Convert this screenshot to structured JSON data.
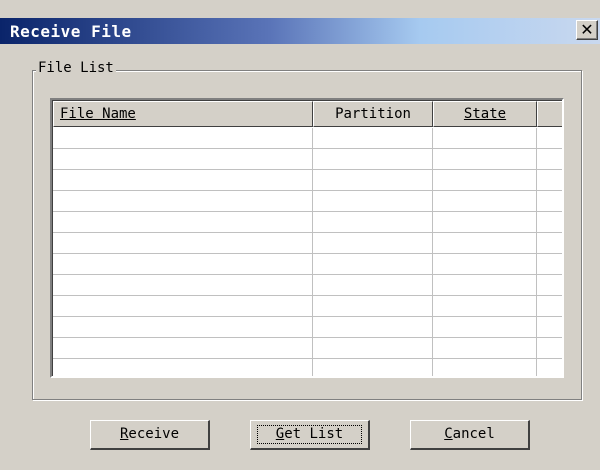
{
  "window": {
    "title": "Receive File",
    "close_glyph": "✕"
  },
  "group": {
    "label": "File List"
  },
  "list": {
    "columns": [
      "File Name",
      "Partition",
      "State",
      ""
    ],
    "rows": [
      [
        "",
        "",
        "",
        ""
      ],
      [
        "",
        "",
        "",
        ""
      ],
      [
        "",
        "",
        "",
        ""
      ],
      [
        "",
        "",
        "",
        ""
      ],
      [
        "",
        "",
        "",
        ""
      ],
      [
        "",
        "",
        "",
        ""
      ],
      [
        "",
        "",
        "",
        ""
      ],
      [
        "",
        "",
        "",
        ""
      ],
      [
        "",
        "",
        "",
        ""
      ],
      [
        "",
        "",
        "",
        ""
      ],
      [
        "",
        "",
        "",
        ""
      ],
      [
        "",
        "",
        "",
        ""
      ]
    ]
  },
  "buttons": {
    "receive_mnemonic": "R",
    "receive_rest": "eceive",
    "getlist_mnemonic": "G",
    "getlist_rest": "et List",
    "cancel_mnemonic": "C",
    "cancel_rest": "ancel"
  },
  "colors": {
    "title_start": "#0a246a",
    "face": "#d4d0c8"
  }
}
